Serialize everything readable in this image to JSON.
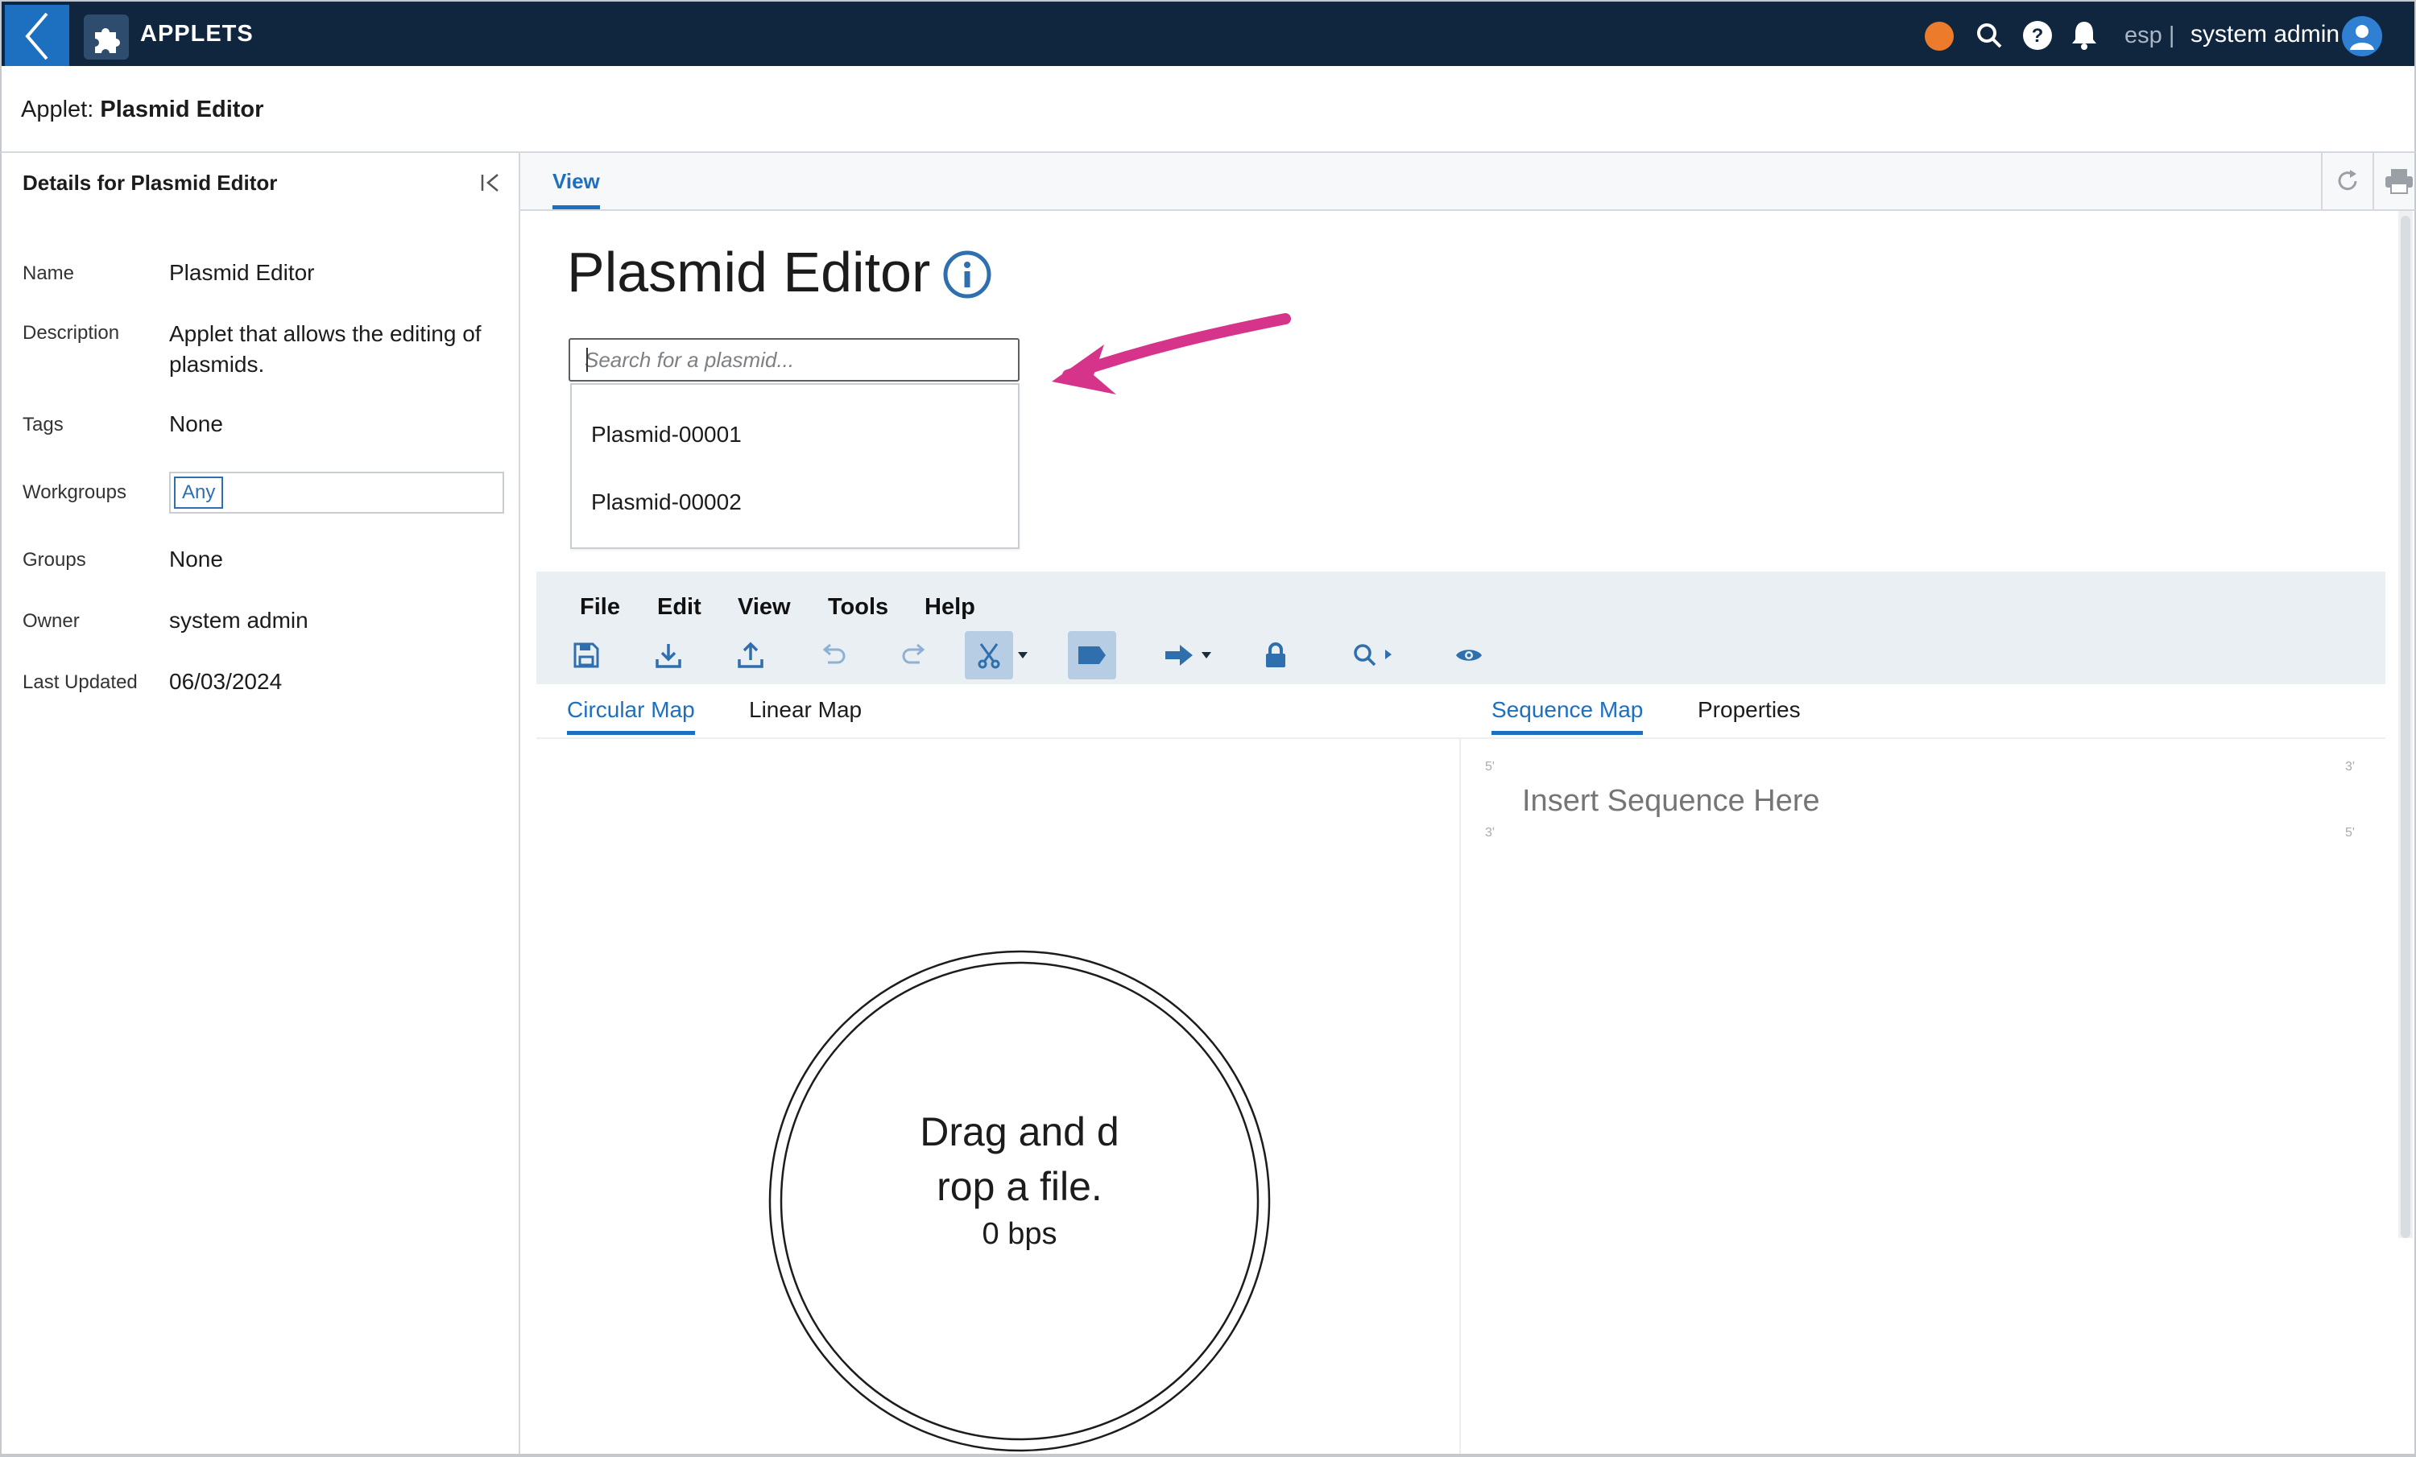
{
  "topbar": {
    "app_title": "APPLETS",
    "language": "esp |",
    "user_name": "system admin",
    "status_color": "#ec7b2b",
    "icons": [
      "back-icon",
      "puzzle-icon",
      "search-icon",
      "help-icon",
      "bell-icon",
      "user-avatar-icon"
    ]
  },
  "applet_header": {
    "prefix": "Applet:",
    "name": "Plasmid Editor"
  },
  "details": {
    "title": "Details for Plasmid Editor",
    "fields": [
      {
        "label": "Name",
        "value": "Plasmid Editor"
      },
      {
        "label": "Description",
        "value": "Applet that allows the editing of plasmids."
      },
      {
        "label": "Tags",
        "value": "None"
      },
      {
        "label": "Workgroups",
        "value": "Any"
      },
      {
        "label": "Groups",
        "value": "None"
      },
      {
        "label": "Owner",
        "value": "system admin"
      },
      {
        "label": "Last Updated",
        "value": "06/03/2024"
      }
    ]
  },
  "view_tab": {
    "label": "View"
  },
  "main": {
    "title": "Plasmid Editor",
    "search": {
      "placeholder": "Search for a plasmid...",
      "value": ""
    },
    "dropdown_items": [
      "Plasmid-00001",
      "Plasmid-00002"
    ]
  },
  "editor": {
    "menus": [
      "File",
      "Edit",
      "View",
      "Tools",
      "Help"
    ],
    "toolbar_icons": [
      "save-icon",
      "download-icon",
      "upload-icon",
      "undo-icon",
      "redo-icon",
      "scissors-icon",
      "tag-icon",
      "arrow-right-icon",
      "lock-icon",
      "search-next-icon",
      "eye-icon"
    ],
    "left_tabs": [
      "Circular Map",
      "Linear Map"
    ],
    "right_tabs": [
      "Sequence Map",
      "Properties"
    ],
    "sequence_placeholder": "Insert Sequence Here",
    "strand_labels": {
      "top_left": "5'",
      "top_right": "3'",
      "bottom_left": "3'",
      "bottom_right": "5'"
    },
    "circular_map": {
      "drop_line1": "Drag and d",
      "drop_line2": "rop a file.",
      "bps": "0 bps"
    }
  },
  "colors": {
    "topbar": "#10263f",
    "accent": "#1d6fbf",
    "annotation_arrow": "#d6338a"
  }
}
